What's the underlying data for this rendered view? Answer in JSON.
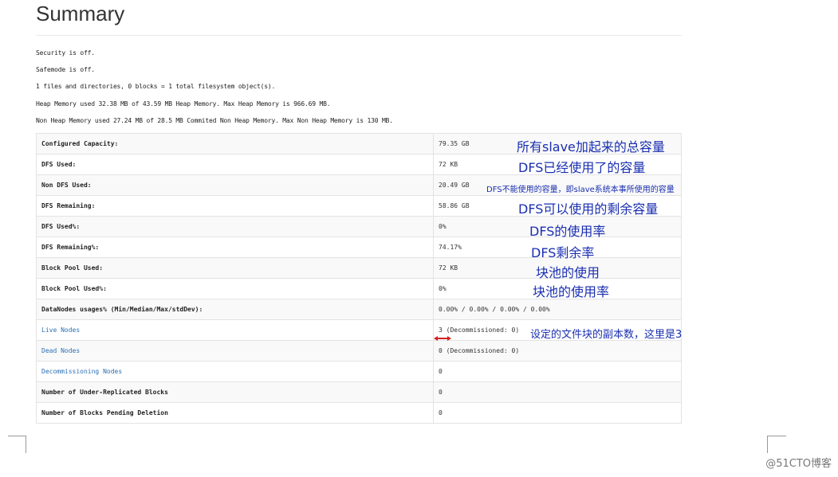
{
  "page": {
    "title": "Summary",
    "info_lines": [
      "Security is off.",
      "Safemode is off.",
      "1 files and directories, 0 blocks = 1 total filesystem object(s).",
      "Heap Memory used 32.38 MB of 43.59 MB Heap Memory. Max Heap Memory is 966.69 MB.",
      "Non Heap Memory used 27.24 MB of 28.5 MB Commited Non Heap Memory. Max Non Heap Memory is 130 MB."
    ]
  },
  "summary_table": {
    "rows": [
      {
        "key": "Configured Capacity:",
        "value": "79.35 GB"
      },
      {
        "key": "DFS Used:",
        "value": "72 KB"
      },
      {
        "key": "Non DFS Used:",
        "value": "20.49 GB"
      },
      {
        "key": "DFS Remaining:",
        "value": "58.86 GB"
      },
      {
        "key": "DFS Used%:",
        "value": "0%"
      },
      {
        "key": "DFS Remaining%:",
        "value": "74.17%"
      },
      {
        "key": "Block Pool Used:",
        "value": "72 KB"
      },
      {
        "key": "Block Pool Used%:",
        "value": "0%"
      },
      {
        "key": "DataNodes usages% (Min/Median/Max/stdDev):",
        "value": "0.00% / 0.00% / 0.00% / 0.00%"
      },
      {
        "key": "Live Nodes",
        "value": "3 (Decommissioned: 0)"
      },
      {
        "key": "Dead Nodes",
        "value": "0 (Decommissioned: 0)"
      },
      {
        "key": "Decommissioning Nodes",
        "value": "0"
      },
      {
        "key": "Number of Under-Replicated Blocks",
        "value": "0"
      },
      {
        "key": "Number of Blocks Pending Deletion",
        "value": "0"
      }
    ]
  },
  "annotations": [
    "所有slave加起来的总容量",
    "DFS已经使用了的容量",
    "DFS不能使用的容量，即slave系统本事所使用的容量",
    "DFS可以使用的剩余容量",
    "DFS的使用率",
    "DFS剩余率",
    "块池的使用",
    "块池的使用率",
    "设定的文件块的副本数，这里是3"
  ],
  "colors": {
    "annotation": "#1a2fb0",
    "link": "#2a6fb3",
    "arrow": "#d42020"
  },
  "watermark": "@51CTO博客"
}
